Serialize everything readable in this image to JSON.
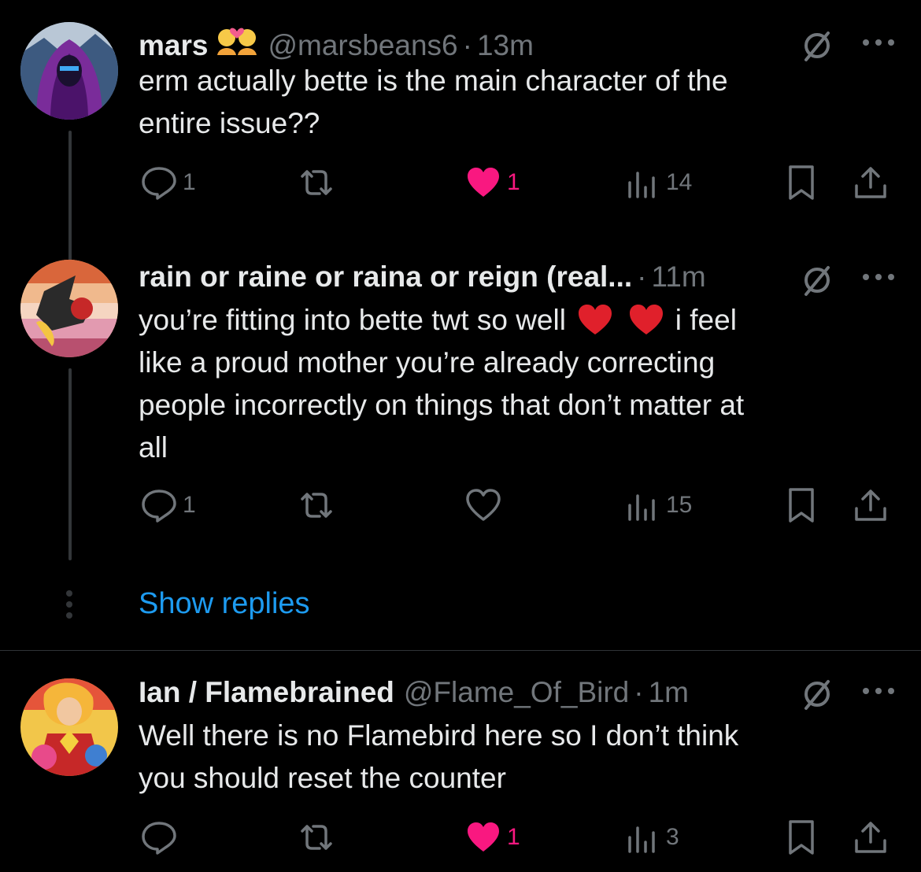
{
  "colors": {
    "background": "#000000",
    "text": "#e7e9ea",
    "muted": "#71767b",
    "link": "#1d9bf0",
    "like": "#f91880"
  },
  "tweets": [
    {
      "name": "mars",
      "name_emoji": "couple-with-heart-emoji",
      "handle": "@marsbeans6",
      "dot": "·",
      "time": "13m",
      "text_lines": [
        "erm actually bette is the main character of the",
        "entire issue??"
      ],
      "replies": "1",
      "retweets": "",
      "likes": "1",
      "liked": true,
      "views": "14"
    },
    {
      "name": "rain or raine or raina or reign (real...",
      "handle": "",
      "dot": "·",
      "time": "11m",
      "text_line1_before": "you’re fitting into bette twt so well",
      "text_line1_after": "i feel",
      "text_lines_rest": [
        "like a proud mother you’re already correcting",
        "people incorrectly on things that don’t matter at",
        "all"
      ],
      "replies": "1",
      "retweets": "",
      "likes": "",
      "liked": false,
      "views": "15"
    },
    {
      "name": "Ian / Flamebrained",
      "handle": "@Flame_Of_Bird",
      "dot": "·",
      "time": "1m",
      "text_lines": [
        "Well there is no Flamebird here so I don’t think",
        "you should reset the counter"
      ],
      "replies": "",
      "retweets": "",
      "likes": "1",
      "liked": true,
      "views": "3"
    }
  ],
  "show_replies": "Show replies"
}
